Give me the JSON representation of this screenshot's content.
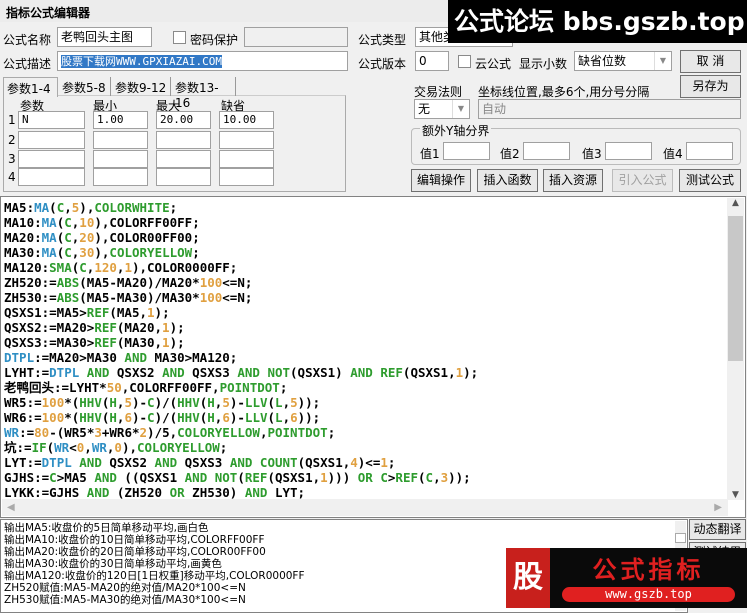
{
  "window": {
    "title": "指标公式编辑器"
  },
  "form": {
    "name_label": "公式名称",
    "name_value": "老鸭回头主图",
    "password_label": "密码保护",
    "password_checked": false,
    "type_label": "公式类型",
    "type_value": "其他类",
    "desc_label": "公式描述",
    "desc_value": "股票下载网WWW.GPXIAZAI.COM",
    "version_label": "公式版本",
    "version_value": "0",
    "cloud_label": "云公式",
    "cloud_checked": false,
    "decimals_label": "显示小数",
    "decimals_value": "缺省位数",
    "cancel_label": "取  消",
    "save_as_label": "另存为",
    "trade_rule_label": "交易法则",
    "trade_rule_value": "无",
    "axis_label": "坐标线位置,最多6个,用分号分隔",
    "axis_value": "自动",
    "extra_axis_label": "额外Y轴分界",
    "extra_values": [
      {
        "label": "值1",
        "value": ""
      },
      {
        "label": "值2",
        "value": ""
      },
      {
        "label": "值3",
        "value": ""
      },
      {
        "label": "值4",
        "value": ""
      }
    ]
  },
  "tabs": [
    {
      "label": "参数1-4",
      "active": true
    },
    {
      "label": "参数5-8"
    },
    {
      "label": "参数9-12"
    },
    {
      "label": "参数13-16"
    }
  ],
  "params": {
    "headers": [
      "参数",
      "最小",
      "最大",
      "缺省"
    ],
    "rows": [
      {
        "no": "1",
        "name": "N",
        "min": "1.00",
        "max": "20.00",
        "default": "10.00"
      },
      {
        "no": "2",
        "name": "",
        "min": "",
        "max": "",
        "default": ""
      },
      {
        "no": "3",
        "name": "",
        "min": "",
        "max": "",
        "default": ""
      },
      {
        "no": "4",
        "name": "",
        "min": "",
        "max": "",
        "default": ""
      }
    ]
  },
  "actions": [
    {
      "label": "编辑操作",
      "enabled": true
    },
    {
      "label": "插入函数",
      "enabled": true
    },
    {
      "label": "插入资源",
      "enabled": true
    },
    {
      "label": "引入公式",
      "enabled": false
    },
    {
      "label": "测试公式",
      "enabled": true
    }
  ],
  "colors": {
    "function": "#2e9c2e",
    "variable": "#2f8fc4",
    "number": "#e0a040"
  },
  "code": [
    [
      [
        "",
        "MA5:"
      ],
      [
        "v",
        "MA"
      ],
      [
        "",
        "("
      ],
      [
        "f",
        "C"
      ],
      [
        "",
        ","
      ],
      [
        "n",
        "5"
      ],
      [
        "",
        "),"
      ],
      [
        "f",
        "COLORWHITE"
      ],
      [
        "",
        ";"
      ]
    ],
    [
      [
        "",
        "MA10:"
      ],
      [
        "v",
        "MA"
      ],
      [
        "",
        "("
      ],
      [
        "f",
        "C"
      ],
      [
        "",
        ","
      ],
      [
        "n",
        "10"
      ],
      [
        "",
        "),COLORFF00FF;"
      ]
    ],
    [
      [
        "",
        "MA20:"
      ],
      [
        "v",
        "MA"
      ],
      [
        "",
        "("
      ],
      [
        "f",
        "C"
      ],
      [
        "",
        ","
      ],
      [
        "n",
        "20"
      ],
      [
        "",
        "),COLOR00FF00;"
      ]
    ],
    [
      [
        "",
        "MA30:"
      ],
      [
        "v",
        "MA"
      ],
      [
        "",
        "("
      ],
      [
        "f",
        "C"
      ],
      [
        "",
        ","
      ],
      [
        "n",
        "30"
      ],
      [
        "",
        "),"
      ],
      [
        "f",
        "COLORYELLOW"
      ],
      [
        "",
        ";"
      ]
    ],
    [
      [
        "",
        "MA120:"
      ],
      [
        "f",
        "SMA"
      ],
      [
        "",
        "("
      ],
      [
        "f",
        "C"
      ],
      [
        "",
        ","
      ],
      [
        "n",
        "120"
      ],
      [
        "",
        ","
      ],
      [
        "n",
        "1"
      ],
      [
        "",
        "),COLOR0000FF;"
      ]
    ],
    [
      [
        "",
        "ZH520:="
      ],
      [
        "f",
        "ABS"
      ],
      [
        "",
        "(MA5-MA20)/MA20*"
      ],
      [
        "n",
        "100"
      ],
      [
        "",
        "<=N;"
      ]
    ],
    [
      [
        "",
        "ZH530:="
      ],
      [
        "f",
        "ABS"
      ],
      [
        "",
        "(MA5-MA30)/MA30*"
      ],
      [
        "n",
        "100"
      ],
      [
        "",
        "<=N;"
      ]
    ],
    [
      [
        "",
        "QSXS1:=MA5>"
      ],
      [
        "f",
        "REF"
      ],
      [
        "",
        "(MA5,"
      ],
      [
        "n",
        "1"
      ],
      [
        "",
        ");"
      ]
    ],
    [
      [
        "",
        "QSXS2:=MA20>"
      ],
      [
        "f",
        "REF"
      ],
      [
        "",
        "(MA20,"
      ],
      [
        "n",
        "1"
      ],
      [
        "",
        ");"
      ]
    ],
    [
      [
        "",
        "QSXS3:=MA30>"
      ],
      [
        "f",
        "REF"
      ],
      [
        "",
        "(MA30,"
      ],
      [
        "n",
        "1"
      ],
      [
        "",
        ");"
      ]
    ],
    [
      [
        "v",
        "DTPL"
      ],
      [
        "",
        ":=MA20>MA30 "
      ],
      [
        "f",
        "AND"
      ],
      [
        "",
        " MA30>MA120;"
      ]
    ],
    [
      [
        "",
        "LYHT:="
      ],
      [
        "v",
        "DTPL"
      ],
      [
        "",
        " "
      ],
      [
        "f",
        "AND"
      ],
      [
        "",
        " QSXS2 "
      ],
      [
        "f",
        "AND"
      ],
      [
        "",
        " QSXS3 "
      ],
      [
        "f",
        "AND"
      ],
      [
        "",
        " "
      ],
      [
        "f",
        "NOT"
      ],
      [
        "",
        "(QSXS1) "
      ],
      [
        "f",
        "AND"
      ],
      [
        "",
        " "
      ],
      [
        "f",
        "REF"
      ],
      [
        "",
        "(QSXS1,"
      ],
      [
        "n",
        "1"
      ],
      [
        "",
        ");"
      ]
    ],
    [
      [
        "",
        "老鸭回头:=LYHT*"
      ],
      [
        "n",
        "50"
      ],
      [
        "",
        ",COLORFF00FF,"
      ],
      [
        "f",
        "POINTDOT"
      ],
      [
        "",
        ";"
      ]
    ],
    [
      [
        "",
        "WR5:="
      ],
      [
        "n",
        "100"
      ],
      [
        "",
        "*("
      ],
      [
        "f",
        "HHV"
      ],
      [
        "",
        "("
      ],
      [
        "f",
        "H"
      ],
      [
        "",
        ","
      ],
      [
        "n",
        "5"
      ],
      [
        "",
        ")-"
      ],
      [
        "f",
        "C"
      ],
      [
        "",
        ")/("
      ],
      [
        "f",
        "HHV"
      ],
      [
        "",
        "("
      ],
      [
        "f",
        "H"
      ],
      [
        "",
        ","
      ],
      [
        "n",
        "5"
      ],
      [
        "",
        ")-"
      ],
      [
        "f",
        "LLV"
      ],
      [
        "",
        "("
      ],
      [
        "f",
        "L"
      ],
      [
        "",
        ","
      ],
      [
        "n",
        "5"
      ],
      [
        "",
        "));"
      ]
    ],
    [
      [
        "",
        "WR6:="
      ],
      [
        "n",
        "100"
      ],
      [
        "",
        "*("
      ],
      [
        "f",
        "HHV"
      ],
      [
        "",
        "("
      ],
      [
        "f",
        "H"
      ],
      [
        "",
        ","
      ],
      [
        "n",
        "6"
      ],
      [
        "",
        ")-"
      ],
      [
        "f",
        "C"
      ],
      [
        "",
        ")/("
      ],
      [
        "f",
        "HHV"
      ],
      [
        "",
        "("
      ],
      [
        "f",
        "H"
      ],
      [
        "",
        ","
      ],
      [
        "n",
        "6"
      ],
      [
        "",
        ")-"
      ],
      [
        "f",
        "LLV"
      ],
      [
        "",
        "("
      ],
      [
        "f",
        "L"
      ],
      [
        "",
        ","
      ],
      [
        "n",
        "6"
      ],
      [
        "",
        "));"
      ]
    ],
    [
      [
        "v",
        "WR"
      ],
      [
        "",
        ":="
      ],
      [
        "n",
        "80"
      ],
      [
        "",
        "-(WR5*"
      ],
      [
        "n",
        "3"
      ],
      [
        "",
        "+WR6*"
      ],
      [
        "n",
        "2"
      ],
      [
        "",
        ")/5,"
      ],
      [
        "f",
        "COLORYELLOW"
      ],
      [
        "",
        ","
      ],
      [
        "f",
        "POINTDOT"
      ],
      [
        "",
        ";"
      ]
    ],
    [
      [
        "",
        "坑:="
      ],
      [
        "f",
        "IF"
      ],
      [
        "",
        "("
      ],
      [
        "v",
        "WR"
      ],
      [
        "",
        "<"
      ],
      [
        "n",
        "0"
      ],
      [
        "",
        ","
      ],
      [
        "v",
        "WR"
      ],
      [
        "",
        ","
      ],
      [
        "n",
        "0"
      ],
      [
        "",
        "),"
      ],
      [
        "f",
        "COLORYELLOW"
      ],
      [
        "",
        ";"
      ]
    ],
    [
      [
        "",
        "LYT:="
      ],
      [
        "v",
        "DTPL"
      ],
      [
        "",
        " "
      ],
      [
        "f",
        "AND"
      ],
      [
        "",
        " QSXS2 "
      ],
      [
        "f",
        "AND"
      ],
      [
        "",
        " QSXS3 "
      ],
      [
        "f",
        "AND"
      ],
      [
        "",
        " "
      ],
      [
        "f",
        "COUNT"
      ],
      [
        "",
        "(QSXS1,"
      ],
      [
        "n",
        "4"
      ],
      [
        "",
        ")<="
      ],
      [
        "n",
        "1"
      ],
      [
        "",
        ";"
      ]
    ],
    [
      [
        "",
        "GJHS:="
      ],
      [
        "f",
        "C"
      ],
      [
        "",
        ">MA5 "
      ],
      [
        "f",
        "AND"
      ],
      [
        "",
        " ((QSXS1 "
      ],
      [
        "f",
        "AND"
      ],
      [
        "",
        " "
      ],
      [
        "f",
        "NOT"
      ],
      [
        "",
        "("
      ],
      [
        "f",
        "REF"
      ],
      [
        "",
        "(QSXS1,"
      ],
      [
        "n",
        "1"
      ],
      [
        "",
        ")))"
      ],
      [
        "",
        " "
      ],
      [
        "f",
        "OR"
      ],
      [
        "",
        " "
      ],
      [
        "f",
        "C"
      ],
      [
        "",
        ">"
      ],
      [
        "f",
        "REF"
      ],
      [
        "",
        "("
      ],
      [
        "f",
        "C"
      ],
      [
        "",
        ","
      ],
      [
        "n",
        "3"
      ],
      [
        "",
        "));"
      ]
    ],
    [
      [
        "",
        "LYKK:=GJHS "
      ],
      [
        "f",
        "AND"
      ],
      [
        "",
        " (ZH520 "
      ],
      [
        "f",
        "OR"
      ],
      [
        "",
        " ZH530) "
      ],
      [
        "f",
        "AND"
      ],
      [
        "",
        " LYT;"
      ]
    ]
  ],
  "output_lines": [
    "输出MA5:收盘价的5日简单移动平均,画白色",
    "输出MA10:收盘价的10日简单移动平均,COLORFF00FF",
    "输出MA20:收盘价的20日简单移动平均,COLOR00FF00",
    "输出MA30:收盘价的30日简单移动平均,画黄色",
    "输出MA120:收盘价的120日[1日权重]移动平均,COLOR0000FF",
    "ZH520赋值:MA5-MA20的绝对值/MA20*100<=N",
    "ZH530赋值:MA5-MA30的绝对值/MA30*100<=N"
  ],
  "side_buttons": {
    "translate": "动态翻译",
    "test_result": "测试结果"
  },
  "watermarks": {
    "top": "公式论坛 bbs.gszb.top",
    "logo_char": "股",
    "logo_title": "公式指标",
    "logo_url": "www.gszb.top"
  }
}
